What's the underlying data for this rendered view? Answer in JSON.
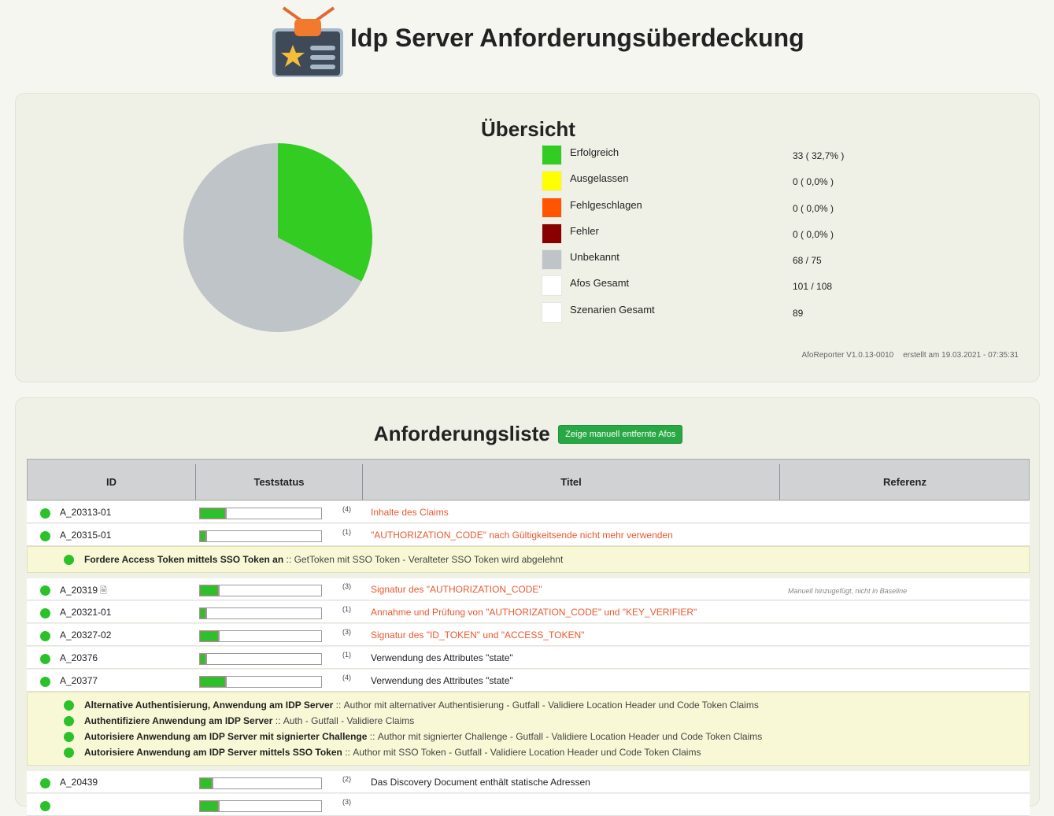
{
  "header": {
    "title": "Idp Server Anforderungsüberdeckung",
    "logo_icon": "badge-star-icon"
  },
  "overview": {
    "title": "Übersicht",
    "legend": [
      {
        "label": "Erfolgreich",
        "value": "33 ( 32,7% )",
        "color": "#33cc22"
      },
      {
        "label": "Ausgelassen",
        "value": "0 ( 0,0% )",
        "color": "#ffff00"
      },
      {
        "label": "Fehlgeschlagen",
        "value": "0 ( 0,0% )",
        "color": "#ff5500"
      },
      {
        "label": "Fehler",
        "value": "0 ( 0,0% )",
        "color": "#880000"
      },
      {
        "label": "Unbekannt",
        "value": "68 / 75",
        "color": "#bfc4c9"
      },
      {
        "label": "Afos Gesamt",
        "value": "101 / 108",
        "color": "#ffffff"
      },
      {
        "label": "Szenarien Gesamt",
        "value": "89",
        "color": "#ffffff"
      }
    ],
    "version": "AfoReporter V1.0.13-0010",
    "created": "erstellt am 19.03.2021 - 07:35:31"
  },
  "chart_data": {
    "type": "pie",
    "categories": [
      "Erfolgreich",
      "Unbekannt"
    ],
    "values": [
      33,
      68
    ],
    "colors": [
      "#33cc22",
      "#bfc4c9"
    ]
  },
  "requirements": {
    "title": "Anforderungsliste",
    "toggle_button": "Zeige manuell entfernte Afos",
    "columns": [
      "ID",
      "Teststatus",
      "Titel",
      "Referenz"
    ],
    "rows": [
      {
        "id": "A_20313-01",
        "progress": 0.22,
        "count": "(4)",
        "title": "Inhalte des Claims",
        "title_red": true,
        "ref": "",
        "note": false
      },
      {
        "id": "A_20315-01",
        "progress": 0.06,
        "count": "(1)",
        "title": "\"AUTHORIZATION_CODE\" nach Gültigkeitsende nicht mehr verwenden",
        "title_red": true,
        "ref": "",
        "note": false,
        "scenarios": [
          {
            "name": "Fordere Access Token mittels SSO Token an",
            "sep": "::",
            "desc": "GetToken mit SSO Token - Veralteter SSO Token wird abgelehnt"
          }
        ]
      },
      {
        "id": "A_20319",
        "progress": 0.16,
        "count": "(3)",
        "title": "Signatur des \"AUTHORIZATION_CODE\"",
        "title_red": true,
        "ref": "Manuell hinzugefügt, nicht in Baseline",
        "note": true
      },
      {
        "id": "A_20321-01",
        "progress": 0.06,
        "count": "(1)",
        "title": "Annahme und Prüfung von \"AUTHORIZATION_CODE\" und \"KEY_VERIFIER\"",
        "title_red": true,
        "ref": "",
        "note": false
      },
      {
        "id": "A_20327-02",
        "progress": 0.16,
        "count": "(3)",
        "title": "Signatur des \"ID_TOKEN\" und \"ACCESS_TOKEN\"",
        "title_red": true,
        "ref": "",
        "note": false
      },
      {
        "id": "A_20376",
        "progress": 0.06,
        "count": "(1)",
        "title": "Verwendung des Attributes \"state\"",
        "title_red": false,
        "ref": "",
        "note": false
      },
      {
        "id": "A_20377",
        "progress": 0.22,
        "count": "(4)",
        "title": "Verwendung des Attributes \"state\"",
        "title_red": false,
        "ref": "",
        "note": false,
        "scenarios": [
          {
            "name": "Alternative Authentisierung, Anwendung am IDP Server",
            "sep": "::",
            "desc": "Author mit alternativer Authentisierung - Gutfall - Validiere Location Header und Code Token Claims"
          },
          {
            "name": "Authentifiziere Anwendung am IDP Server",
            "sep": "::",
            "desc": "Auth - Gutfall - Validiere Claims"
          },
          {
            "name": "Autorisiere Anwendung am IDP Server mit signierter Challenge",
            "sep": "::",
            "desc": "Author mit signierter Challenge - Gutfall - Validiere Location Header und Code Token Claims"
          },
          {
            "name": "Autorisiere Anwendung am IDP Server mittels SSO Token",
            "sep": "::",
            "desc": "Author mit SSO Token - Gutfall - Validiere Location Header und Code Token Claims"
          }
        ]
      },
      {
        "id": "A_20439",
        "progress": 0.11,
        "count": "(2)",
        "title": "Das Discovery Document enthält statische Adressen",
        "title_red": false,
        "ref": "",
        "note": false
      },
      {
        "id": "",
        "progress": 0.16,
        "count": "(3)",
        "title": "",
        "title_red": false,
        "ref": "",
        "note": false
      }
    ]
  }
}
